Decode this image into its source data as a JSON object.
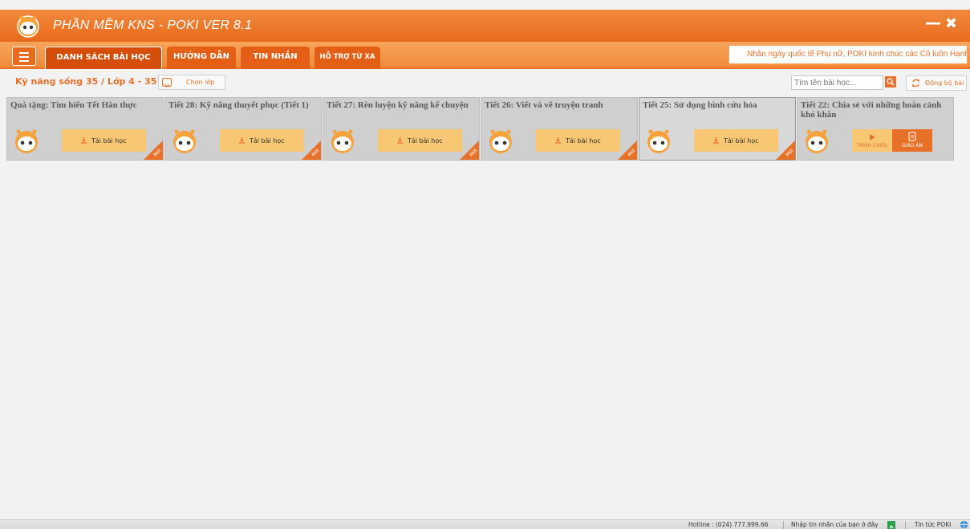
{
  "app": {
    "title": "PHẦN MỀM KNS - POKI VER 8.1",
    "minimize_label": "—",
    "close_label": "✖"
  },
  "tabs": [
    {
      "label": "DANH SÁCH BÀI HỌC",
      "active": true
    },
    {
      "label": "HƯỚNG DẪN",
      "active": false
    },
    {
      "label": "TIN NHẮN",
      "active": false
    },
    {
      "label": "HỖ TRỢ TỪ XA",
      "active": false
    }
  ],
  "marquee_text": "Nhân ngày quốc tế Phụ nữ, POKI kính chúc các Cô luôn Hạnh",
  "subheader": {
    "breadcrumb": "Kỹ năng sống 35 / Lớp 4 - 35",
    "choose_class_label": "Chọn lớp",
    "search_placeholder": "Tìm tên bài học...",
    "sync_label": "Đồng bộ bài"
  },
  "lessons": [
    {
      "title": "Quà tặng: Tìm hiểu Tết Hàn thực",
      "download_label": "Tải bài học",
      "badge": "Mới"
    },
    {
      "title": "Tiết 28: Kỹ năng thuyết phục (Tiết 1)",
      "download_label": "Tải bài học",
      "badge": "Mới"
    },
    {
      "title": "Tiết 27: Rèn luyện kỹ năng kể chuyện",
      "download_label": "Tải bài học",
      "badge": "Mới"
    },
    {
      "title": "Tiết 26: Viết và vẽ truyện tranh",
      "download_label": "Tải bài học",
      "badge": "Mới"
    },
    {
      "title": "Tiết 25: Sử dụng bình cứu hỏa",
      "download_label": "Tải bài học",
      "badge": "Mới"
    },
    {
      "title": "Tiết 22: Chia sẻ với những hoàn cảnh khó khăn",
      "present_label": "TRÌNH CHIẾU",
      "lesson_plan_label": "GIÁO ÁN"
    }
  ],
  "statusbar": {
    "hotline": "Hotline : (024) 777.999.66",
    "message_prompt": "Nhập tin nhắn của bạn ở đây",
    "news": "Tin tức POKI"
  },
  "colors": {
    "brand_orange": "#e8712a",
    "tile_gray": "#cfcfcf",
    "download_yellow": "#f8c774"
  }
}
